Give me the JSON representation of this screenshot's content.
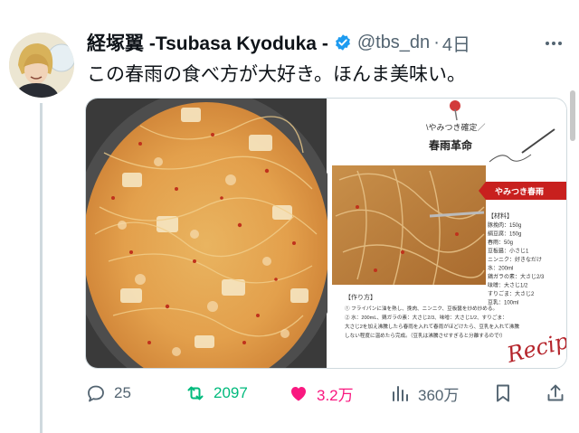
{
  "tweet": {
    "author_name": "経塚翼 -Tsubasa Kyoduka -",
    "handle": "@tbs_dn",
    "separator": "·",
    "time": "4日",
    "text": "この春雨の食べ方が大好き。ほんま美味い。",
    "more_icon": "more-horizontal-icon"
  },
  "media": {
    "recipe_label": "\\やみつき確定／",
    "recipe_title": "春雨革命",
    "banner": "やみつき春雨",
    "ingredients_header": "【材料】",
    "ingredients": [
      "豚挽肉：150g",
      "絹豆腐：150g",
      "春雨：50g",
      "豆板醤：小さじ1",
      "ニンニク：好きなだけ",
      "水：200ml",
      "鶏ガラの素：大さじ2/3",
      "味噌：大さじ1/2",
      "すりごま：大さじ2",
      "豆乳：100ml"
    ],
    "steps_header": "【作り方】",
    "steps": [
      "① フライパンに油を熱し、挽肉、ニンニク、豆板醤を炒め炒める。",
      "② 水：200mL、鶏ガラの素：大さじ2/3、味噌：大さじ1/2、すりごま：",
      "大さじ2を加え沸騰したら春雨を入れて春雨がほどけたら、豆乳を入れて沸騰",
      "しない程度に温めたら完成。（豆乳は沸騰させすぎると分離するので!）"
    ],
    "script_text": "Recipe"
  },
  "actions": {
    "reply_count": "25",
    "retweet_count": "2097",
    "like_count": "3.2万",
    "views_count": "360万"
  },
  "colors": {
    "retweet_active": "#00ba7c",
    "like_active": "#f91880",
    "verified": "#1d9bf0",
    "muted": "#536471",
    "banner_red": "#c8201e"
  }
}
